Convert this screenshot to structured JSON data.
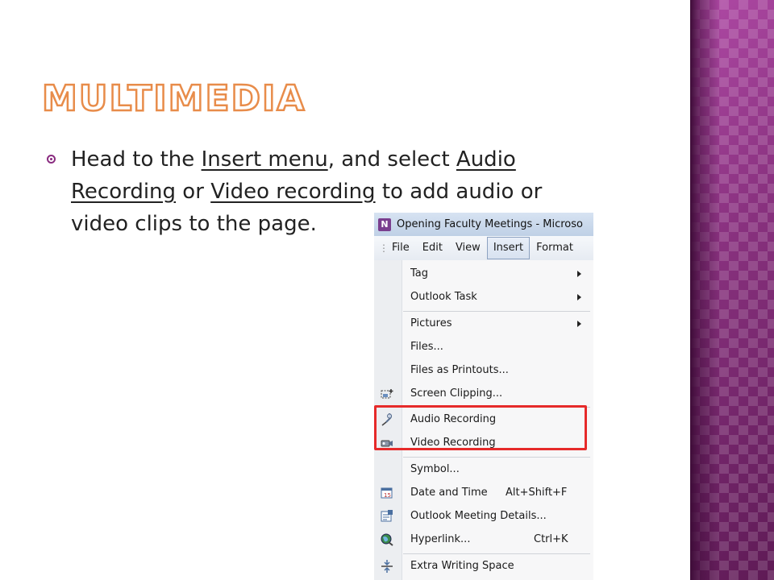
{
  "slide": {
    "title": "Multimedia",
    "bullet": {
      "line1_prefix": "Head to the ",
      "line1_link1": "Insert menu",
      "line1_mid": ", and select ",
      "line1_link2": "Audio",
      "line2_link2_cont": "Recording",
      "line2_mid": " or ",
      "line2_link3": "Video recording",
      "line2_suffix": " to add audio or",
      "line3": "video clips to the page."
    }
  },
  "window": {
    "title": "Opening Faculty Meetings - Microso",
    "menus": [
      "File",
      "Edit",
      "View",
      "Insert",
      "Format"
    ],
    "active_menu": "Insert"
  },
  "insert_menu": {
    "items": [
      {
        "label": "Tag",
        "submenu": true
      },
      {
        "label": "Outlook Task",
        "submenu": true
      },
      {
        "label": "Pictures",
        "submenu": true
      },
      {
        "label": "Files..."
      },
      {
        "label": "Files as Printouts..."
      },
      {
        "label": "Screen Clipping...",
        "icon": "screen-clipping-icon"
      },
      {
        "label": "Audio Recording",
        "icon": "microphone-icon"
      },
      {
        "label": "Video Recording",
        "icon": "video-camera-icon"
      },
      {
        "label": "Symbol..."
      },
      {
        "label": "Date and Time",
        "shortcut": "Alt+Shift+F",
        "icon": "calendar-icon"
      },
      {
        "label": "Outlook Meeting Details...",
        "icon": "meeting-details-icon"
      },
      {
        "label": "Hyperlink...",
        "shortcut": "Ctrl+K",
        "icon": "globe-icon"
      },
      {
        "label": "Extra Writing Space",
        "icon": "extra-space-icon"
      }
    ]
  },
  "colors": {
    "title_outline": "#e88c4a",
    "side_panel": "#7a2c6e",
    "highlight_border": "#e62a2a"
  }
}
